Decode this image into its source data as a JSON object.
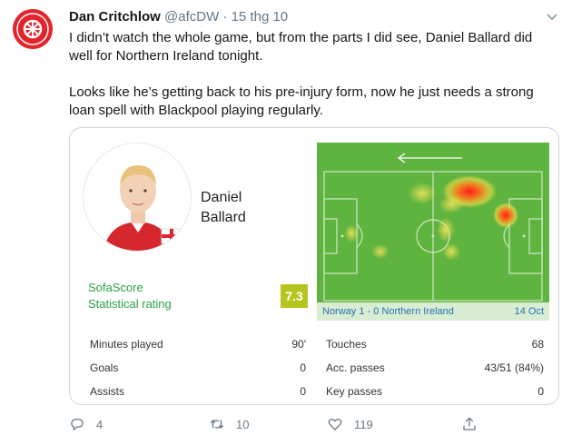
{
  "tweet": {
    "display_name": "Dan Critchlow",
    "handle": "@afcDW",
    "separator": "·",
    "date": "15 thg 10",
    "paragraphs": [
      "I didn’t watch the whole game, but from the parts I did see, Daniel Ballard did well for Northern Ireland tonight.",
      "Looks like he’s getting back to his pre-injury form, now he just needs a strong loan spell with Blackpool playing regularly."
    ]
  },
  "card": {
    "player_first": "Daniel",
    "player_last": "Ballard",
    "sofascore_label": "SofaScore",
    "rating_label": "Statistical rating",
    "rating": "7.3",
    "match": "Norway 1 - 0 Northern Ireland",
    "match_date": "14 Oct",
    "stats_left": [
      {
        "label": "Minutes played",
        "value": "90'"
      },
      {
        "label": "Goals",
        "value": "0"
      },
      {
        "label": "Assists",
        "value": "0"
      }
    ],
    "stats_right": [
      {
        "label": "Touches",
        "value": "68"
      },
      {
        "label": "Acc. passes",
        "value": "43/51 (84%)"
      },
      {
        "label": "Key passes",
        "value": "0"
      }
    ]
  },
  "actions": {
    "replies": "4",
    "retweets": "10",
    "likes": "119"
  },
  "colors": {
    "rating_bg": "#b6c51e",
    "pitch": "#5fb33f",
    "sofascore_green": "#2aa13f",
    "avatar_red": "#e4242d"
  },
  "icons": [
    "arsenal-cannon-avatar",
    "chevron-down-icon",
    "reply-icon",
    "retweet-icon",
    "like-icon",
    "share-icon",
    "direction-arrow-icon"
  ]
}
